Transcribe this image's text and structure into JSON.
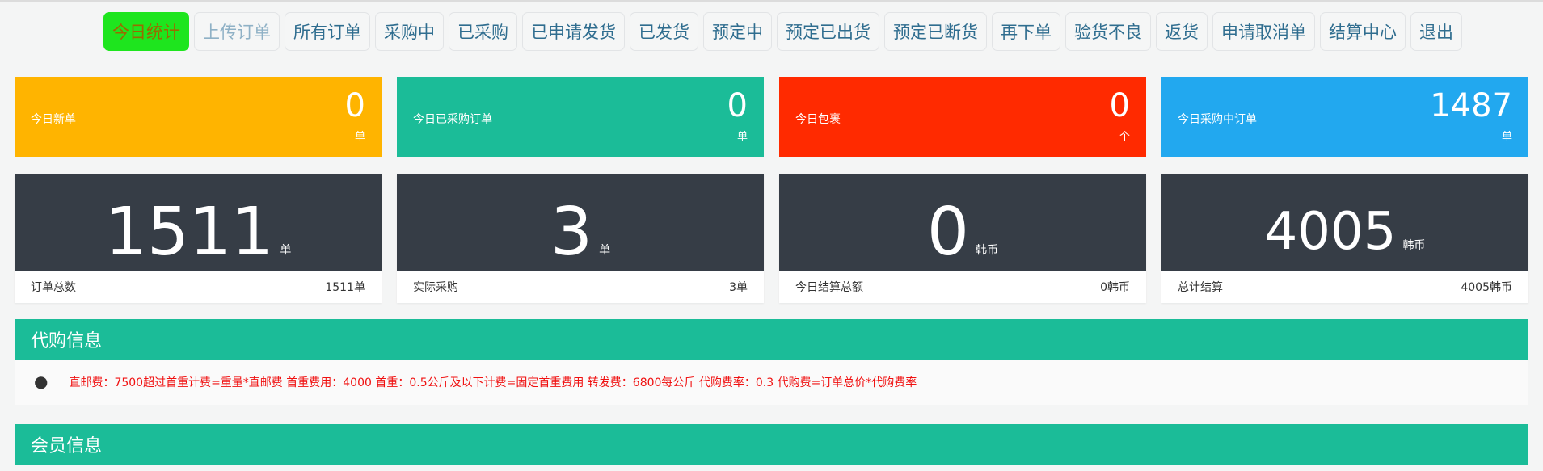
{
  "nav": [
    {
      "label": "今日统计",
      "state": "active"
    },
    {
      "label": "上传订单",
      "state": "muted"
    },
    {
      "label": "所有订单",
      "state": ""
    },
    {
      "label": "采购中",
      "state": ""
    },
    {
      "label": "已采购",
      "state": ""
    },
    {
      "label": "已申请发货",
      "state": ""
    },
    {
      "label": "已发货",
      "state": ""
    },
    {
      "label": "预定中",
      "state": ""
    },
    {
      "label": "预定已出货",
      "state": ""
    },
    {
      "label": "预定已断货",
      "state": ""
    },
    {
      "label": "再下单",
      "state": ""
    },
    {
      "label": "验货不良",
      "state": ""
    },
    {
      "label": "返货",
      "state": ""
    },
    {
      "label": "申请取消单",
      "state": ""
    },
    {
      "label": "结算中心",
      "state": ""
    },
    {
      "label": "退出",
      "state": ""
    }
  ],
  "stats_top": [
    {
      "label": "今日新单",
      "value": "0",
      "unit": "单",
      "color": "#ffb400"
    },
    {
      "label": "今日已采购订单",
      "value": "0",
      "unit": "单",
      "color": "#1bbc98"
    },
    {
      "label": "今日包裹",
      "value": "0",
      "unit": "个",
      "color": "#ff2a00"
    },
    {
      "label": "今日采购中订单",
      "value": "1487",
      "unit": "单",
      "color": "#22a8ef"
    }
  ],
  "stats_bottom": [
    {
      "value": "1511",
      "unit": "单",
      "label": "订单总数",
      "footer_value": "1511单"
    },
    {
      "value": "3",
      "unit": "单",
      "label": "实际采购",
      "footer_value": "3单"
    },
    {
      "value": "0",
      "unit": "韩币",
      "label": "今日结算总额",
      "footer_value": "0韩币"
    },
    {
      "value": "4005",
      "unit": "韩币",
      "label": "总计结算",
      "footer_value": "4005韩币"
    }
  ],
  "daigou": {
    "title": "代购信息",
    "text": "直邮费：7500超过首重计费=重量*直邮费  首重费用：4000  首重：0.5公斤及以下计费=固定首重费用  转发费：6800每公斤  代购费率：0.3  代购费=订单总价*代购费率"
  },
  "member": {
    "title": "会员信息"
  }
}
